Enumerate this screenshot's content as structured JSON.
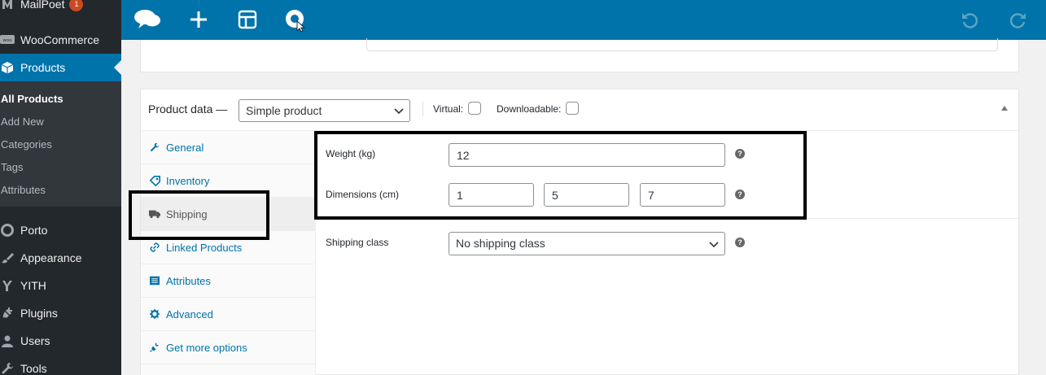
{
  "colors": {
    "admin_bar": "#23282d",
    "accent": "#0073aa",
    "submenu_bg": "#32373c",
    "badge": "#ca4a1f"
  },
  "sidebar": {
    "items": [
      {
        "label": "MailPoet",
        "icon": "mailpoet-icon",
        "badge": "1"
      },
      {
        "label": "WooCommerce",
        "icon": "woocommerce-icon"
      },
      {
        "label": "Products",
        "icon": "products-box-icon",
        "active": true
      },
      {
        "label": "Porto",
        "icon": "porto-icon"
      },
      {
        "label": "Appearance",
        "icon": "paintbrush-icon"
      },
      {
        "label": "YITH",
        "icon": "yith-icon"
      },
      {
        "label": "Plugins",
        "icon": "plug-icon"
      },
      {
        "label": "Users",
        "icon": "user-icon"
      },
      {
        "label": "Tools",
        "icon": "wrench-icon"
      }
    ],
    "submenu": [
      {
        "label": "All Products",
        "current": true
      },
      {
        "label": "Add New"
      },
      {
        "label": "Categories"
      },
      {
        "label": "Tags"
      },
      {
        "label": "Attributes"
      }
    ]
  },
  "toolbar": {
    "icons": [
      "chat-bubbles-icon",
      "plus-icon",
      "layout-icon",
      "search-cursor-icon",
      "undo-icon",
      "redo-icon"
    ]
  },
  "product_data": {
    "title": "Product data —",
    "type_select": "Simple product",
    "virtual_label": "Virtual:",
    "downloadable_label": "Downloadable:",
    "virtual_checked": false,
    "downloadable_checked": false,
    "tabs": [
      {
        "label": "General",
        "icon": "wrench-icon"
      },
      {
        "label": "Inventory",
        "icon": "tag-icon"
      },
      {
        "label": "Shipping",
        "icon": "truck-icon",
        "active": true
      },
      {
        "label": "Linked Products",
        "icon": "link-icon"
      },
      {
        "label": "Attributes",
        "icon": "list-icon"
      },
      {
        "label": "Advanced",
        "icon": "gear-icon"
      },
      {
        "label": "Get more options",
        "icon": "plugin-icon"
      }
    ],
    "shipping": {
      "weight_label": "Weight (kg)",
      "weight_value": "12",
      "dimensions_label": "Dimensions (cm)",
      "length": "1",
      "width": "5",
      "height": "7",
      "shipping_class_label": "Shipping class",
      "shipping_class_value": "No shipping class",
      "help_glyph": "?"
    }
  }
}
